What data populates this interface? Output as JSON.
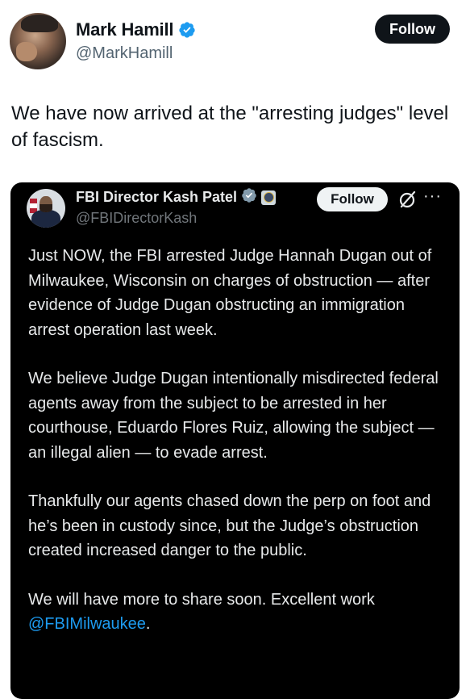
{
  "post": {
    "author_name": "Mark Hamill",
    "author_handle": "@MarkHamill",
    "follow_label": "Follow",
    "text": "We have now arrived at the \"arresting judges\" level of fascism.",
    "verified_icon": "verified-badge-icon"
  },
  "embedded": {
    "author_name": "FBI Director Kash Patel",
    "author_handle": "@FBIDirectorKash",
    "follow_label": "Follow",
    "more_label": "···",
    "paragraphs": [
      "Just NOW, the FBI arrested Judge Hannah Dugan out of Milwaukee, Wisconsin on charges of obstruction — after evidence of Judge Dugan obstructing an immigration arrest operation last week.",
      "We believe Judge Dugan intentionally misdirected federal agents away from the subject to be arrested in her courthouse, Eduardo Flores Ruiz, allowing the subject — an illegal alien — to evade arrest.",
      "Thankfully our agents chased down the perp on foot and he’s been in custody since, but the Judge’s obstruction created increased danger to the public."
    ],
    "last_paragraph_text": "We will have more to share soon. Excellent work ",
    "mention": "@FBIMilwaukee",
    "last_paragraph_end": "."
  },
  "colors": {
    "verified_blue": "#1d9bf0",
    "mention_blue": "#1d9bf0",
    "gov_badge_gray": "#829aab",
    "embed_background": "#000000"
  }
}
